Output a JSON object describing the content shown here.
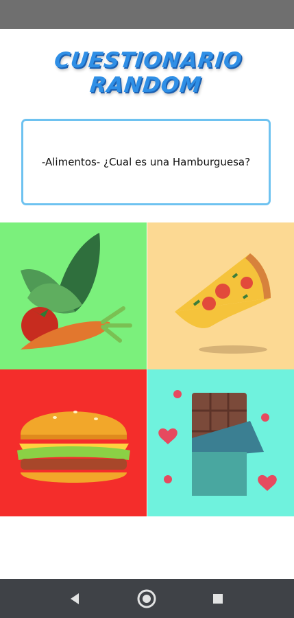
{
  "app": {
    "title": "CUESTIONARIO RANDOM"
  },
  "question": {
    "text": "-Alimentos- ¿Cual es una Hamburguesa?"
  },
  "options": [
    {
      "id": "vegetables",
      "icon": "vegetables-image",
      "bg": "#7bf07c"
    },
    {
      "id": "pizza",
      "icon": "pizza-slice-image",
      "bg": "#fcd993"
    },
    {
      "id": "hamburger",
      "icon": "hamburger-image",
      "bg": "#f42d2b"
    },
    {
      "id": "chocolate",
      "icon": "chocolate-bar-image",
      "bg": "#6ff2dd"
    }
  ],
  "nav": {
    "back_icon": "back-triangle-icon",
    "home_icon": "home-circle-icon",
    "recent_icon": "recent-square-icon"
  },
  "colors": {
    "title": "#2f8fe6",
    "card_border": "#6ec2f0",
    "status_bar": "#6f6f6f",
    "nav_bar": "#3f4247"
  }
}
